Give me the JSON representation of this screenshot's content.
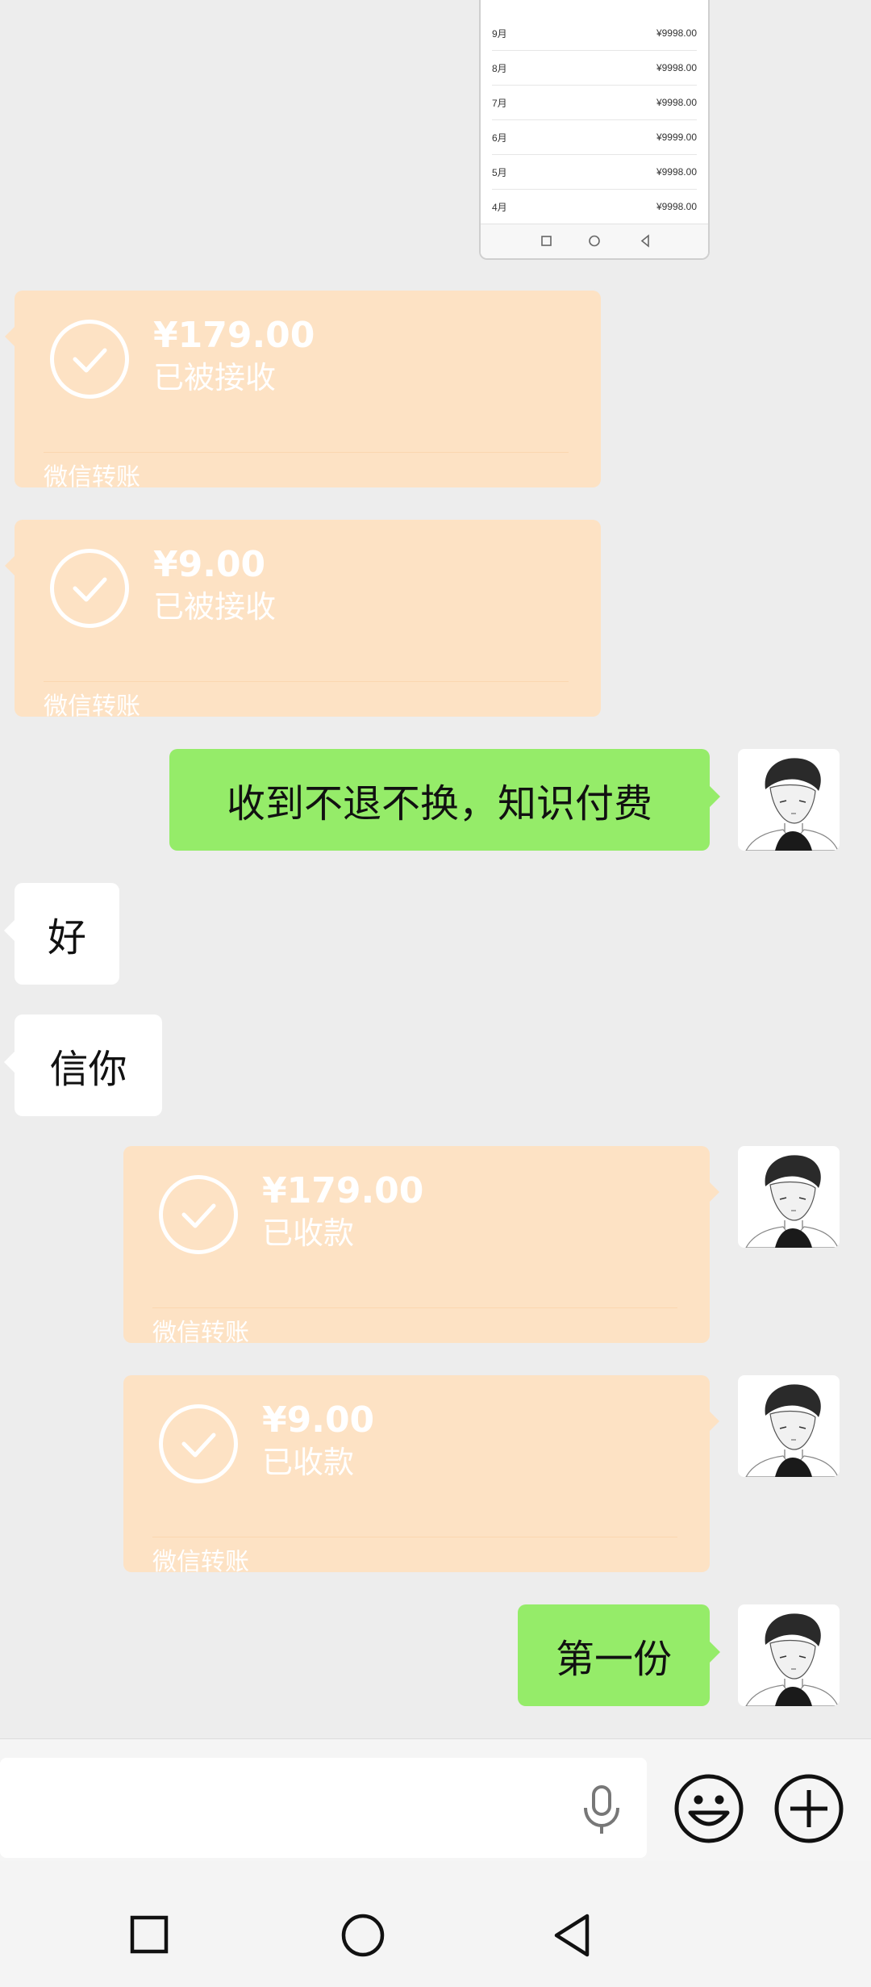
{
  "shot_image": {
    "rows": [
      {
        "month": "9月",
        "amount": "¥9998.00"
      },
      {
        "month": "8月",
        "amount": "¥9998.00"
      },
      {
        "month": "7月",
        "amount": "¥9998.00"
      },
      {
        "month": "6月",
        "amount": "¥9999.00"
      },
      {
        "month": "5月",
        "amount": "¥9998.00"
      },
      {
        "month": "4月",
        "amount": "¥9998.00"
      }
    ]
  },
  "messages": [
    {
      "type": "transfer",
      "side": "left",
      "amount": "¥179.00",
      "status": "已被接收",
      "label": "微信转账"
    },
    {
      "type": "transfer",
      "side": "left",
      "amount": "¥9.00",
      "status": "已被接收",
      "label": "微信转账"
    },
    {
      "type": "text",
      "side": "right",
      "text": "收到不退不换，知识付费"
    },
    {
      "type": "text",
      "side": "left",
      "text": "好"
    },
    {
      "type": "text",
      "side": "left",
      "text": "信你"
    },
    {
      "type": "transfer",
      "side": "right",
      "amount": "¥179.00",
      "status": "已收款",
      "label": "微信转账"
    },
    {
      "type": "transfer",
      "side": "right",
      "amount": "¥9.00",
      "status": "已收款",
      "label": "微信转账"
    },
    {
      "type": "text",
      "side": "right",
      "text": "第一份"
    }
  ],
  "input_bar": {
    "icons": [
      "microphone-icon",
      "emoji-icon",
      "plus-icon"
    ]
  },
  "nav_bar": {
    "icons": [
      "recent-apps-icon",
      "home-icon",
      "back-icon"
    ]
  },
  "colors": {
    "background": "#ededed",
    "transfer_card": "#fde2c4",
    "my_bubble": "#95ec69",
    "their_bubble": "#ffffff"
  }
}
